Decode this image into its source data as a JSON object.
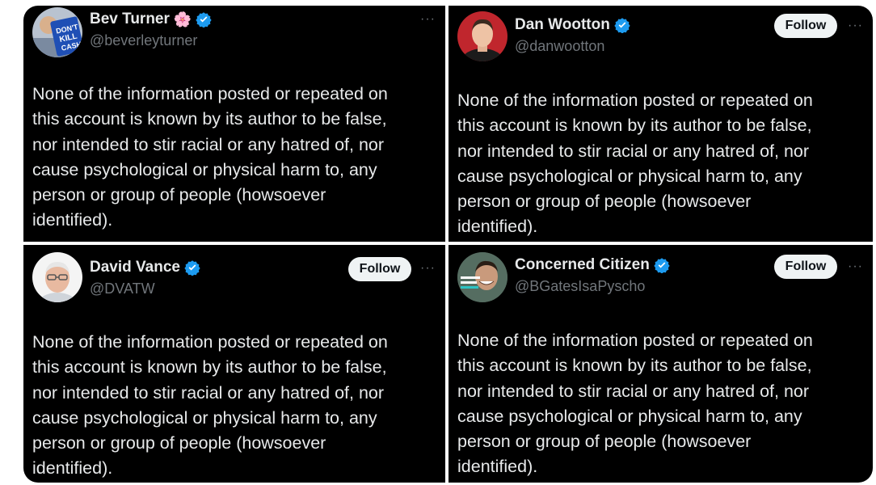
{
  "cards": [
    {
      "name": "Bev Turner",
      "emoji": "🌸",
      "handle": "@beverleyturner",
      "verified": true,
      "show_follow": false,
      "follow_label": "",
      "avatar_icon": "avatar-dont-kill-cash-sign",
      "avatar_text": [
        "DON'T",
        "KILL",
        "CASH"
      ],
      "bio_lines": [
        "None of the information posted or repeated on",
        "this account is known by its author to be false,",
        "nor intended to stir racial or any hatred of, nor",
        "cause psychological or physical harm to, any",
        "person or group of people (howsoever",
        "identified)."
      ]
    },
    {
      "name": "Dan Wootton",
      "handle": "@danwootton",
      "verified": true,
      "show_follow": true,
      "follow_label": "Follow",
      "avatar_icon": "avatar-man-red-background",
      "bio_lines": [
        "None of the information posted or repeated on",
        "this account is known by its author to be false,",
        "nor intended to stir racial or any hatred of, nor",
        "cause psychological or physical harm to, any",
        "person or group of people (howsoever",
        "identified)."
      ]
    },
    {
      "name": "David Vance",
      "handle": "@DVATW",
      "verified": true,
      "show_follow": true,
      "follow_label": "Follow",
      "avatar_icon": "avatar-older-man-glasses",
      "bio_lines": [
        "None of the information posted or repeated on",
        "this account is known by its author to be false,",
        "nor intended to stir racial or any hatred of, nor",
        "cause psychological or physical harm to, any",
        "person or group of people (howsoever",
        "identified)."
      ]
    },
    {
      "name": "Concerned Citizen",
      "handle": "@BGatesIsaPyscho",
      "verified": true,
      "show_follow": true,
      "follow_label": "Follow",
      "avatar_icon": "avatar-smiling-man-meme",
      "bio_lines": [
        "None of the information posted or repeated on",
        "this account is known by its author to be false,",
        "nor intended to stir racial or any hatred of, nor",
        "cause psychological or physical harm to, any",
        "person or group of people (howsoever",
        "identified)."
      ]
    }
  ],
  "more_icon": "···",
  "colors": {
    "card_bg": "#000000",
    "text": "#e7e9ea",
    "muted": "#71767b",
    "verified": "#1d9bf0",
    "follow_bg": "#eff3f4",
    "page_bg": "#ffffff"
  }
}
